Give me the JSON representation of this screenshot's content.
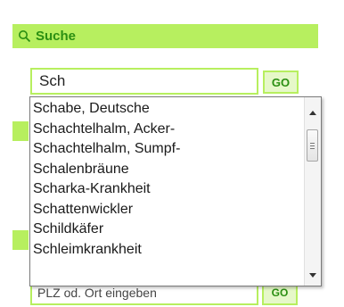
{
  "search": {
    "title": "Suche",
    "input_value": "Sch",
    "go_label": "GO",
    "accent_color": "#b7ef5f",
    "title_color": "#2b8f12"
  },
  "background_field": {
    "text": "PLZ od. Ort eingeben",
    "go_label": "GO"
  },
  "suggestions": [
    "Schabe, Deutsche",
    "Schachtelhalm, Acker-",
    "Schachtelhalm, Sumpf-",
    "Schalenbräune",
    "Scharka-Krankheit",
    "Schattenwickler",
    "Schildkäfer",
    "Schleimkrankheit"
  ]
}
